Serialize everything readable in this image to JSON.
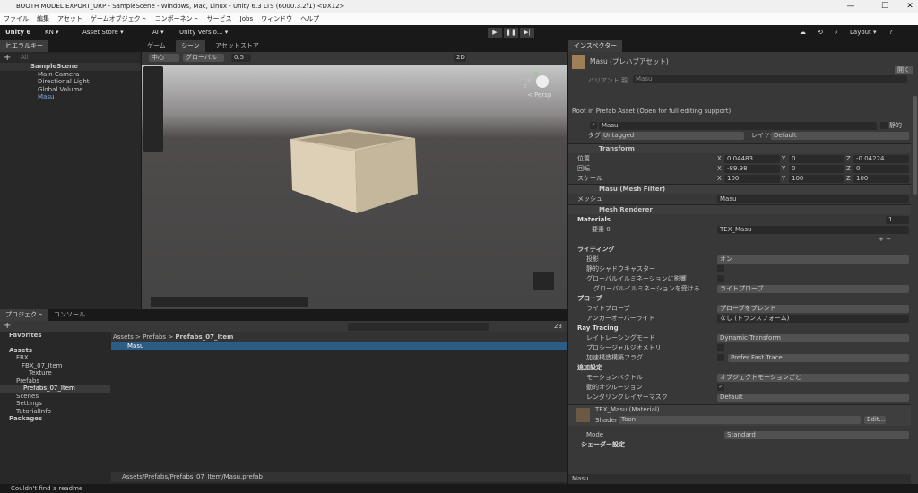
{
  "window": {
    "title": "BOOTH MODEL EXPORT_URP - SampleScene - Windows, Mac, Linux - Unity 6.3 LTS (6000.3.2f1) <DX12>",
    "minimize": "—",
    "maximize": "☐",
    "close": "✕"
  },
  "menu": [
    "ファイル",
    "編集",
    "アセット",
    "ゲームオブジェクト",
    "コンポーネント",
    "サービス",
    "Jobs",
    "ウィンドウ",
    "ヘルプ"
  ],
  "toolbar": {
    "unity": "Unity 6",
    "account": "KN ▾",
    "asset_store": "Asset Store ▾",
    "ai": "AI ▾",
    "version_control": "Unity Versio... ▾",
    "layout": "Layout ▾",
    "play": "▶",
    "pause": "❚❚",
    "step": "▶|"
  },
  "hierarchy": {
    "tab": "ヒエラルキー",
    "search_placeholder": "All",
    "scene": "SampleScene",
    "items": [
      "Main Camera",
      "Directional Light",
      "Global Volume",
      "Masu"
    ]
  },
  "scene_view": {
    "tabs": [
      "ゲーム",
      "シーン",
      "アセットストア"
    ],
    "pivot": "中心",
    "space": "グローバル",
    "snap": "0.5",
    "mode_2d": "2D",
    "persp": "< Persp",
    "axis_y": "y",
    "axis_x": "x",
    "axis_z": "z"
  },
  "inspector": {
    "tab": "インスペクター",
    "asset_title": "Masu (プレハブアセット)",
    "open_button": "開く",
    "variant_label": "バリアント 親",
    "variant_value": "Masu",
    "root_notice": "Root in Prefab Asset (Open for full editing support)",
    "object_name": "Masu",
    "static_label": "静的",
    "tag_label": "タグ",
    "tag_value": "Untagged",
    "layer_label": "レイヤー",
    "layer_value": "Default",
    "transform": {
      "title": "Transform",
      "position_label": "位置",
      "rotation_label": "回転",
      "scale_label": "スケール",
      "position": [
        "0.04483",
        "0",
        "-0.04224"
      ],
      "rotation": [
        "-89.98",
        "0",
        "0"
      ],
      "scale": [
        "100",
        "100",
        "100"
      ]
    },
    "mesh_filter": {
      "title": "Masu (Mesh Filter)",
      "mesh_label": "メッシュ",
      "mesh_value": "Masu"
    },
    "mesh_renderer": {
      "title": "Mesh Renderer",
      "materials_label": "Materials",
      "materials_count": "1",
      "element_label": "要素 0",
      "element_value": "TEX_Masu",
      "lighting": {
        "title": "ライティング",
        "cast_shadows_label": "投影",
        "cast_shadows": "オン",
        "static_shadow_label": "静的シャドウキャスター",
        "contribute_gi_label": "グローバルイルミネーションに影響",
        "receive_gi_label": "グローバルイルミネーションを受ける",
        "receive_gi": "ライトプローブ"
      },
      "probes": {
        "title": "プローブ",
        "light_probes_label": "ライトプローブ",
        "light_probes": "プローブをブレンド",
        "anchor_label": "アンカーオーバーライド",
        "anchor": "なし (トランスフォーム)"
      },
      "ray_tracing": {
        "title": "Ray Tracing",
        "mode_label": "レイトレーシングモード",
        "mode": "Dynamic Transform",
        "procedural_label": "プロシージャルジオメトリ",
        "accel_label": "加速構造構築フラグ",
        "accel": "Prefer Fast Trace"
      },
      "additional": {
        "title": "追加設定",
        "motion_label": "モーションベクトル",
        "motion": "オブジェクトモーションごと",
        "dynamic_occlusion_label": "動的オクルージョン",
        "rendering_layer_label": "レンダリングレイヤーマスク",
        "rendering_layer": "Default"
      }
    },
    "material": {
      "title": "TEX_Masu (Material)",
      "shader_label": "Shader",
      "shader": "Toon",
      "edit_button": "Edit...",
      "mode_label": "Mode",
      "mode": "Standard",
      "shader_settings": "シェーダー設定"
    },
    "footer": "Masu"
  },
  "project": {
    "tabs": [
      "プロジェクト",
      "コンソール"
    ],
    "hidden_count": "23",
    "breadcrumb": [
      "Assets",
      "Prefabs",
      "Prefabs_07_Item"
    ],
    "tree": [
      "Favorites",
      "Assets",
      "FBX",
      "FBX_07_Item",
      "Texture",
      "Prefabs",
      "Prefabs_07_Item",
      "Scenes",
      "Settings",
      "TutorialInfo",
      "Packages"
    ],
    "files": [
      "Masu"
    ],
    "path": "Assets/Prefabs/Prefabs_07_Item/Masu.prefab"
  },
  "status": {
    "message": "Couldn't find a readme"
  },
  "colors": {
    "selection": "#2c5d87",
    "panel": "#282828",
    "inspector": "#383838",
    "accent_blue": "#4a90d9"
  }
}
